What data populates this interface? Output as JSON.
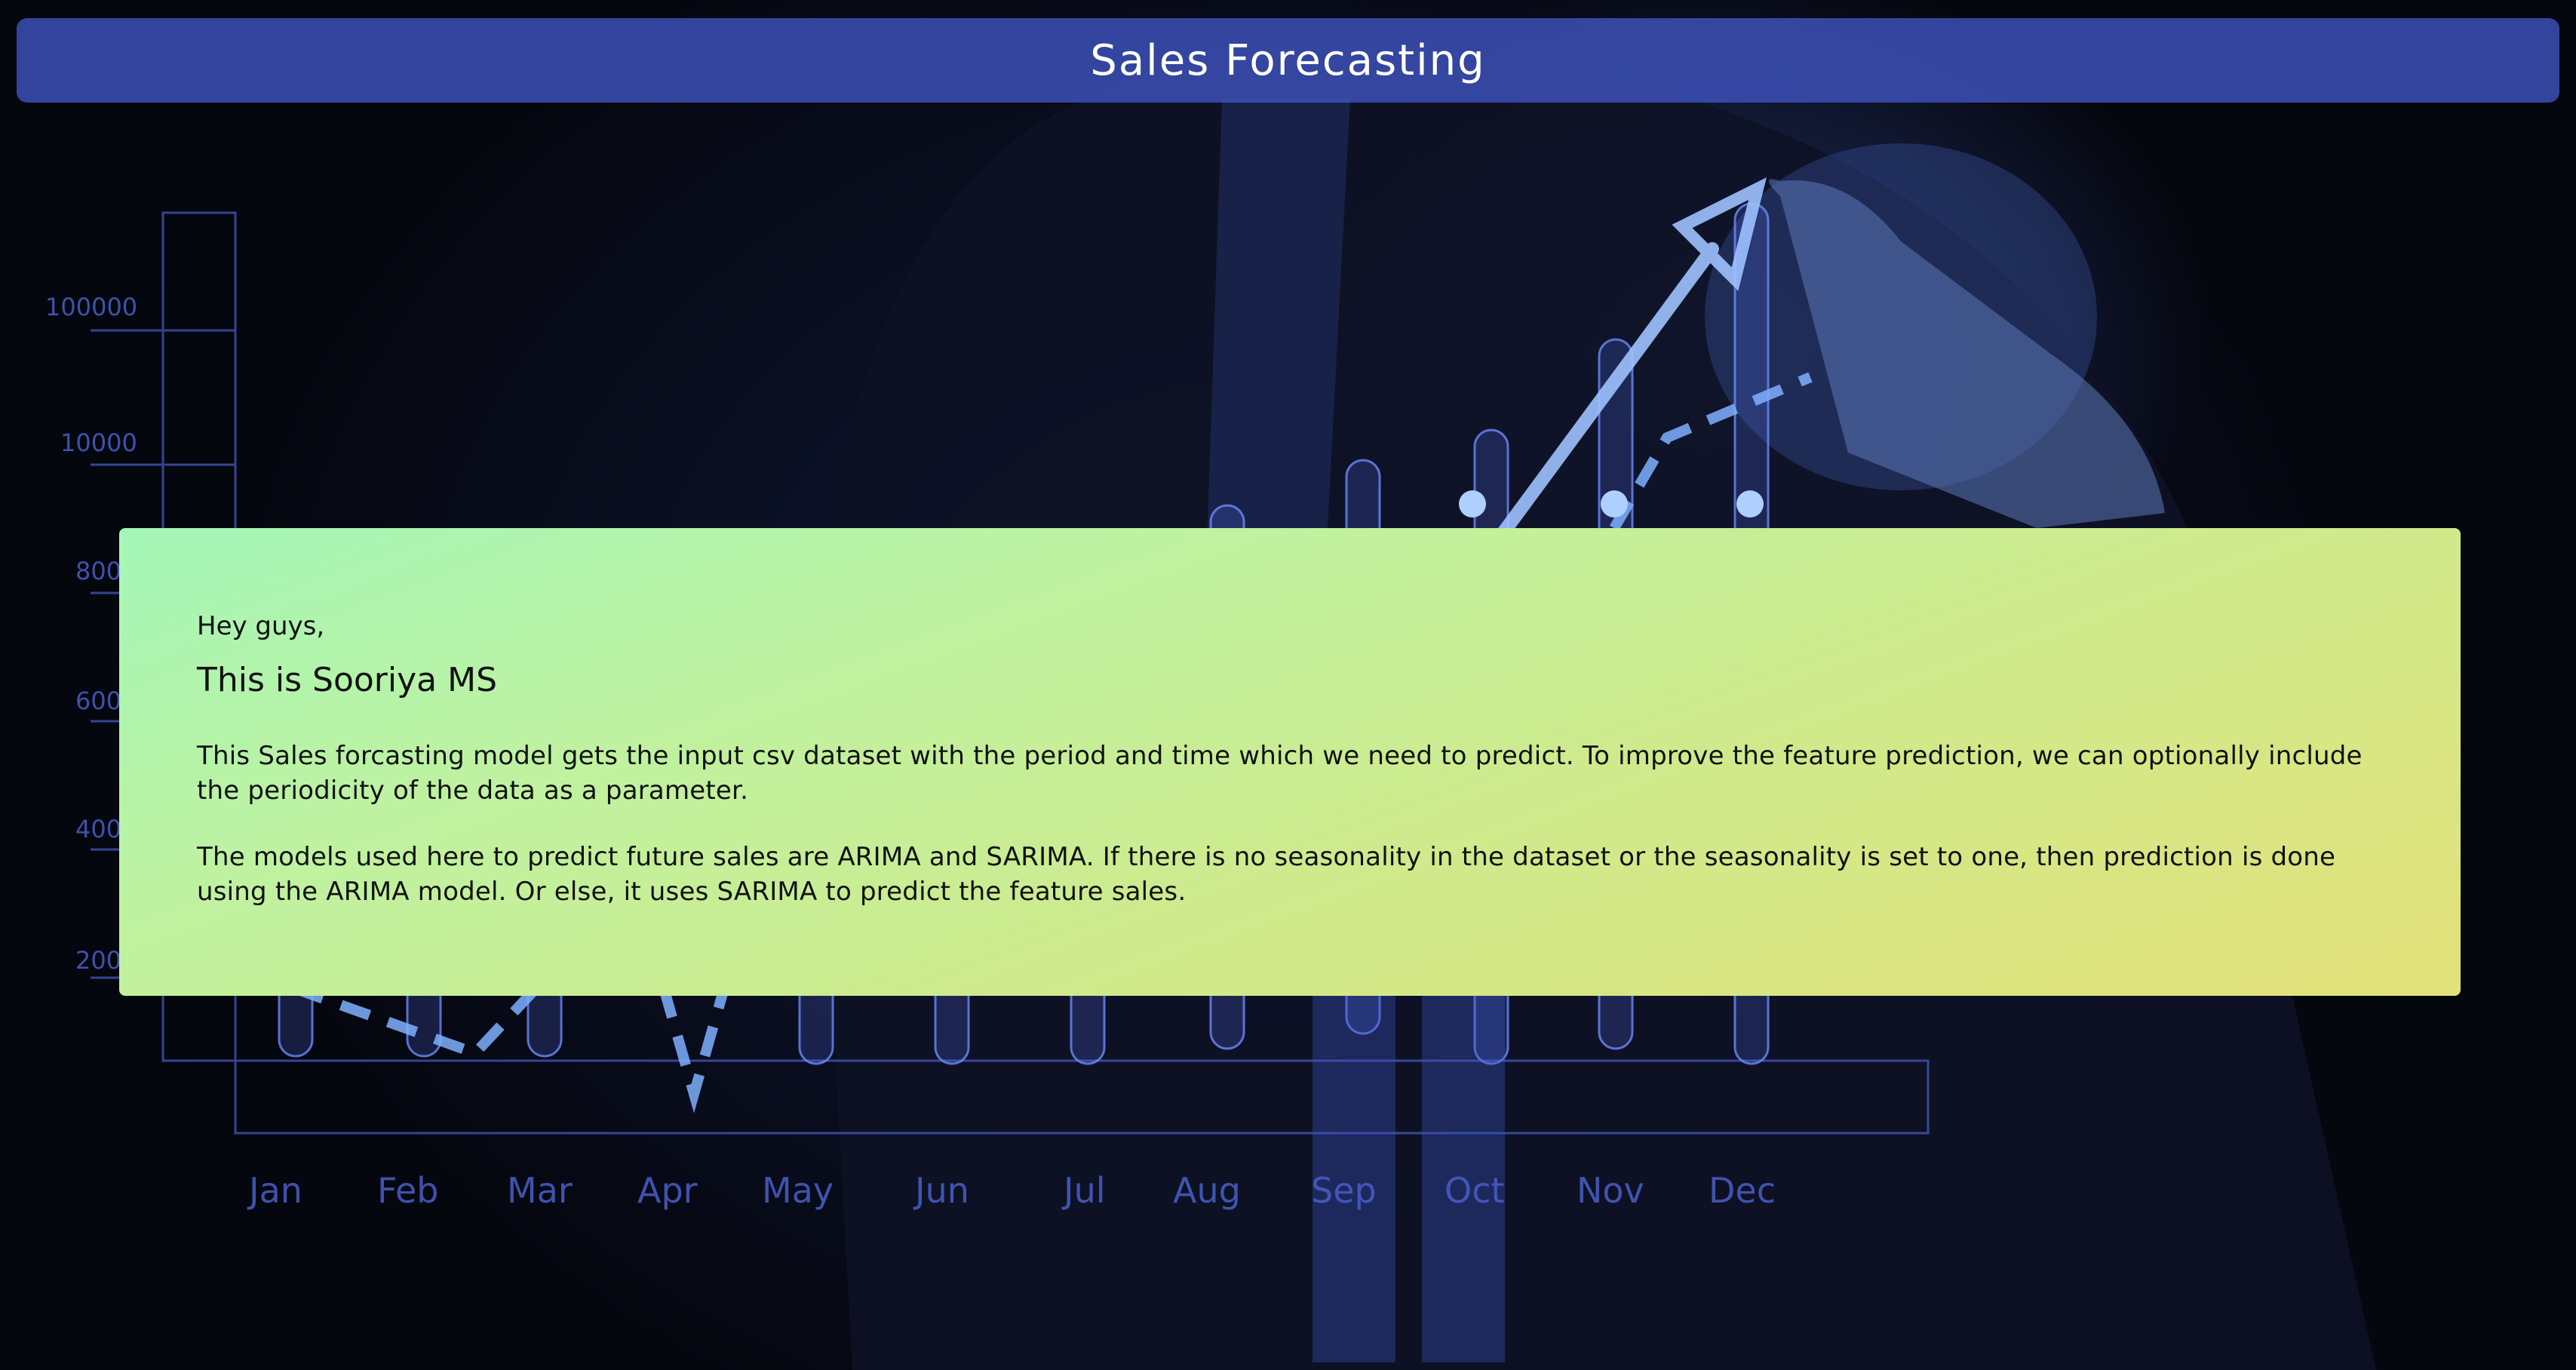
{
  "header": {
    "title": "Sales Forecasting"
  },
  "background": {
    "y_axis_labels": [
      "100000",
      "10000",
      "800",
      "600",
      "400",
      "200"
    ],
    "month_labels": [
      "Jan",
      "Feb",
      "Mar",
      "Apr",
      "May",
      "Jun",
      "Jul",
      "Aug",
      "Sep",
      "Oct",
      "Nov",
      "Dec"
    ]
  },
  "intro": {
    "greeting": "Hey guys,",
    "name": "This is Sooriya MS",
    "paragraph_1": "This Sales forcasting model gets the input csv dataset with the period and time which we need to predict. To improve the feature prediction, we can optionally include the periodicity of the data as a parameter.",
    "paragraph_2": "The models used here to predict future sales are ARIMA and SARIMA. If there is no seasonality in the dataset or the seasonality is set to one, then prediction is done using the ARIMA model. Or else, it uses SARIMA to predict the feature sales."
  },
  "colors": {
    "header_background": "#4056c4",
    "card_gradient_start": "#a4f6b8",
    "card_gradient_end": "#e3e17a",
    "chart_glow": "#6d8cff"
  }
}
